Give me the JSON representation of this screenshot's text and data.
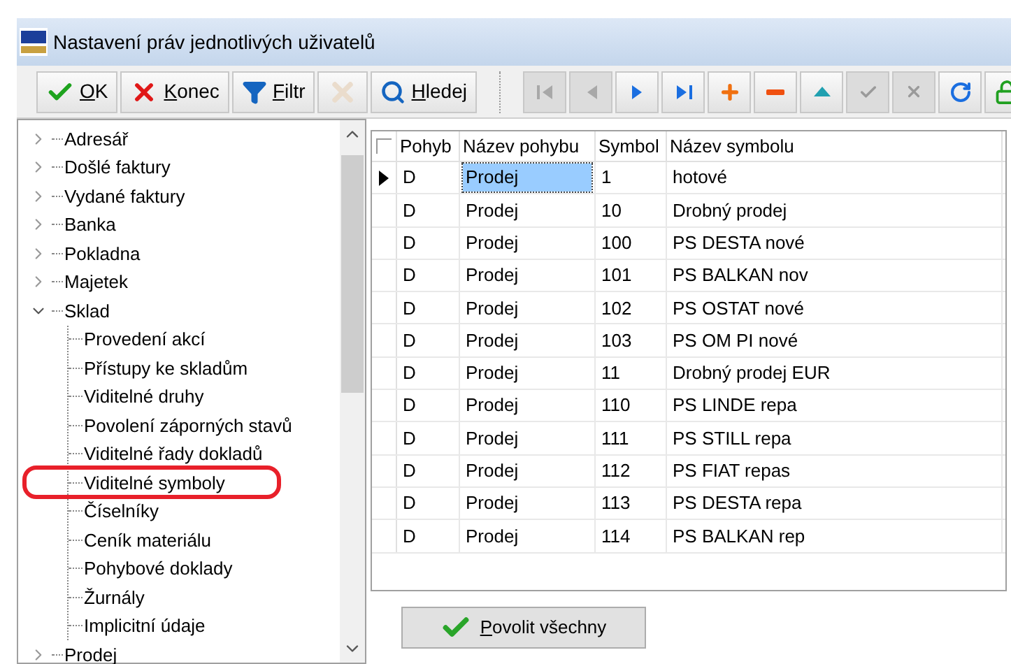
{
  "window": {
    "title": "Nastavení práv jednotlivých uživatelů"
  },
  "toolbar": {
    "buttons": [
      {
        "kind": "ok",
        "label": "OK",
        "disabled": false
      },
      {
        "kind": "close",
        "label": "Konec",
        "disabled": false
      },
      {
        "kind": "filter",
        "label": "Filtr",
        "disabled": false
      },
      {
        "kind": "clear",
        "disabled": true
      },
      {
        "kind": "search",
        "label": "Hledej",
        "disabled": false
      }
    ],
    "navigator": [
      {
        "kind": "first",
        "disabled": true
      },
      {
        "kind": "prev",
        "disabled": true
      },
      {
        "kind": "next",
        "disabled": false
      },
      {
        "kind": "last",
        "disabled": false
      },
      {
        "kind": "add",
        "disabled": false
      },
      {
        "kind": "delete",
        "disabled": false
      },
      {
        "kind": "edit",
        "disabled": false
      },
      {
        "kind": "post",
        "disabled": true
      },
      {
        "kind": "cancel",
        "disabled": true
      },
      {
        "kind": "refresh",
        "disabled": false
      },
      {
        "kind": "lock",
        "disabled": false
      }
    ]
  },
  "tree": {
    "items": [
      {
        "label": "Adresář",
        "expanded": false
      },
      {
        "label": "Došlé faktury",
        "expanded": false
      },
      {
        "label": "Vydané faktury",
        "expanded": false
      },
      {
        "label": "Banka",
        "expanded": false
      },
      {
        "label": "Pokladna",
        "expanded": false
      },
      {
        "label": "Majetek",
        "expanded": false
      },
      {
        "label": "Sklad",
        "expanded": true,
        "children": [
          {
            "label": "Provedení akcí",
            "circled": false
          },
          {
            "label": "Přístupy ke skladům",
            "circled": false
          },
          {
            "label": "Viditelné druhy",
            "circled": false
          },
          {
            "label": "Povolení záporných stavů",
            "circled": false
          },
          {
            "label": "Viditelné řady dokladů",
            "circled": false
          },
          {
            "label": "Viditelné symboly",
            "circled": true
          },
          {
            "label": "Číselníky",
            "circled": false
          },
          {
            "label": "Ceník materiálu",
            "circled": false
          },
          {
            "label": "Pohybové doklady",
            "circled": false
          },
          {
            "label": "Žurnály",
            "circled": false
          },
          {
            "label": "Implicitní údaje",
            "circled": false
          }
        ]
      },
      {
        "label": "Prodej",
        "expanded": false
      }
    ]
  },
  "grid": {
    "select_all": {
      "checked": false
    },
    "columns": [
      "Pohyb",
      "Název pohybu",
      "Symbol",
      "Název symbolu"
    ],
    "rows": [
      {
        "selected": true,
        "cells": [
          "D",
          "Prodej",
          "1",
          "hotové"
        ]
      },
      {
        "selected": false,
        "cells": [
          "D",
          "Prodej",
          "10",
          "Drobný prodej"
        ]
      },
      {
        "selected": false,
        "cells": [
          "D",
          "Prodej",
          "100",
          "PS DESTA nové"
        ]
      },
      {
        "selected": false,
        "cells": [
          "D",
          "Prodej",
          "101",
          "PS BALKAN nov"
        ]
      },
      {
        "selected": false,
        "cells": [
          "D",
          "Prodej",
          "102",
          "PS OSTAT nové"
        ]
      },
      {
        "selected": false,
        "cells": [
          "D",
          "Prodej",
          "103",
          "PS OM PI nové"
        ]
      },
      {
        "selected": false,
        "cells": [
          "D",
          "Prodej",
          "11",
          "Drobný prodej EUR"
        ]
      },
      {
        "selected": false,
        "cells": [
          "D",
          "Prodej",
          "110",
          "PS LINDE repa"
        ]
      },
      {
        "selected": false,
        "cells": [
          "D",
          "Prodej",
          "111",
          "PS STILL repa"
        ]
      },
      {
        "selected": false,
        "cells": [
          "D",
          "Prodej",
          "112",
          "PS FIAT repas"
        ]
      },
      {
        "selected": false,
        "cells": [
          "D",
          "Prodej",
          "113",
          "PS DESTA repa"
        ]
      },
      {
        "selected": false,
        "cells": [
          "D",
          "Prodej",
          "114",
          "PS BALKAN rep"
        ]
      }
    ]
  },
  "allow_all_button": {
    "label": "Povolit všechny"
  }
}
